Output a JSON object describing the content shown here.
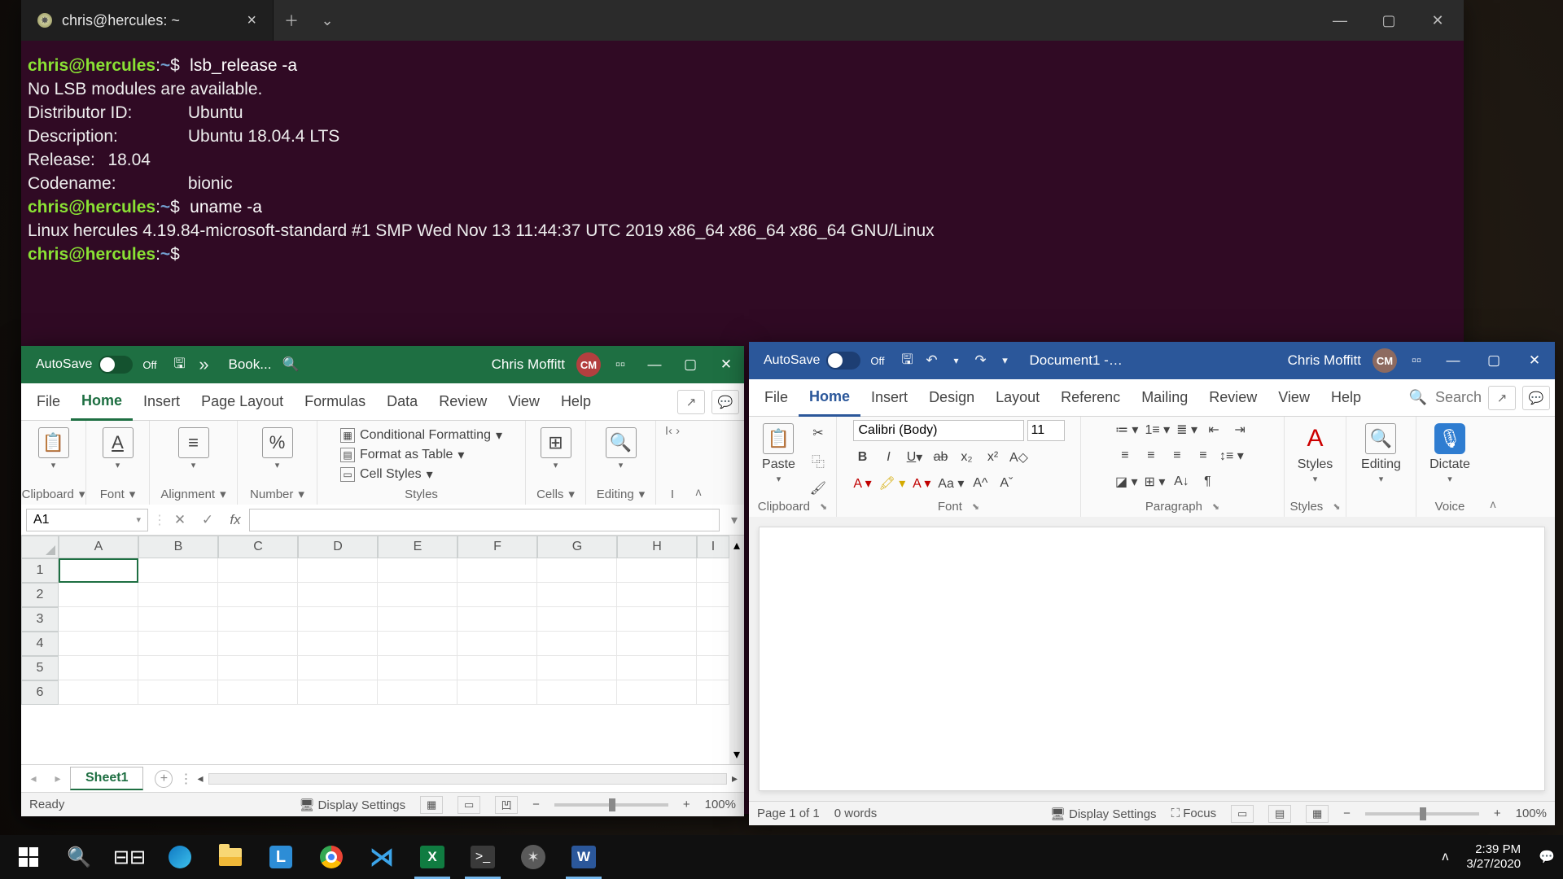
{
  "terminal": {
    "tab_title": "chris@hercules: ~",
    "lines": {
      "l1_cmd": "lsb_release -a",
      "l2": "No LSB modules are available.",
      "l3": "Distributor ID:\tUbuntu",
      "l4": "Description:\tUbuntu 18.04.4 LTS",
      "l5": "Release:\t18.04",
      "l6": "Codename:\tbionic",
      "l7_cmd": "uname -a",
      "l8": "Linux hercules 4.19.84-microsoft-standard #1 SMP Wed Nov 13 11:44:37 UTC 2019 x86_64 x86_64 x86_64 GNU/Linux"
    },
    "prompt_user": "chris@hercules",
    "prompt_sep": ":",
    "prompt_path": "~",
    "prompt_sym": "$"
  },
  "excel": {
    "autosave_label": "AutoSave",
    "autosave_state": "Off",
    "doc_title": "Book...",
    "user_name": "Chris Moffitt",
    "user_initials": "CM",
    "tabs": {
      "file": "File",
      "home": "Home",
      "insert": "Insert",
      "page_layout": "Page Layout",
      "formulas": "Formulas",
      "data": "Data",
      "review": "Review",
      "view": "View",
      "help": "Help"
    },
    "groups": {
      "clipboard": "Clipboard",
      "font": "Font",
      "alignment": "Alignment",
      "number": "Number",
      "styles": "Styles",
      "cells": "Cells",
      "editing": "Editing"
    },
    "styles_items": {
      "cond": "Conditional Formatting",
      "table": "Format as Table",
      "cell": "Cell Styles"
    },
    "namebox": "A1",
    "columns": [
      "A",
      "B",
      "C",
      "D",
      "E",
      "F",
      "G",
      "H",
      "I"
    ],
    "rows": [
      "1",
      "2",
      "3",
      "4",
      "5",
      "6"
    ],
    "sheet_name": "Sheet1",
    "status_ready": "Ready",
    "display_settings": "Display Settings",
    "zoom": "100%"
  },
  "word": {
    "autosave_label": "AutoSave",
    "autosave_state": "Off",
    "doc_title": "Document1  -…",
    "user_name": "Chris Moffitt",
    "user_initials": "CM",
    "tabs": {
      "file": "File",
      "home": "Home",
      "insert": "Insert",
      "design": "Design",
      "layout": "Layout",
      "references": "Referenc",
      "mailings": "Mailing",
      "review": "Review",
      "view": "View",
      "help": "Help"
    },
    "search_placeholder": "Search",
    "font_name": "Calibri (Body)",
    "font_size": "11",
    "groups": {
      "clipboard": "Clipboard",
      "font": "Font",
      "paragraph": "Paragraph",
      "styles": "Styles",
      "editing": "Editing",
      "voice": "Voice"
    },
    "paste_label": "Paste",
    "styles_label": "Styles",
    "editing_label": "Editing",
    "dictate_label": "Dictate",
    "status_page": "Page 1 of 1",
    "status_words": "0 words",
    "display_settings": "Display Settings",
    "focus": "Focus",
    "zoom": "100%"
  },
  "taskbar": {
    "time": "2:39 PM",
    "date": "3/27/2020"
  }
}
